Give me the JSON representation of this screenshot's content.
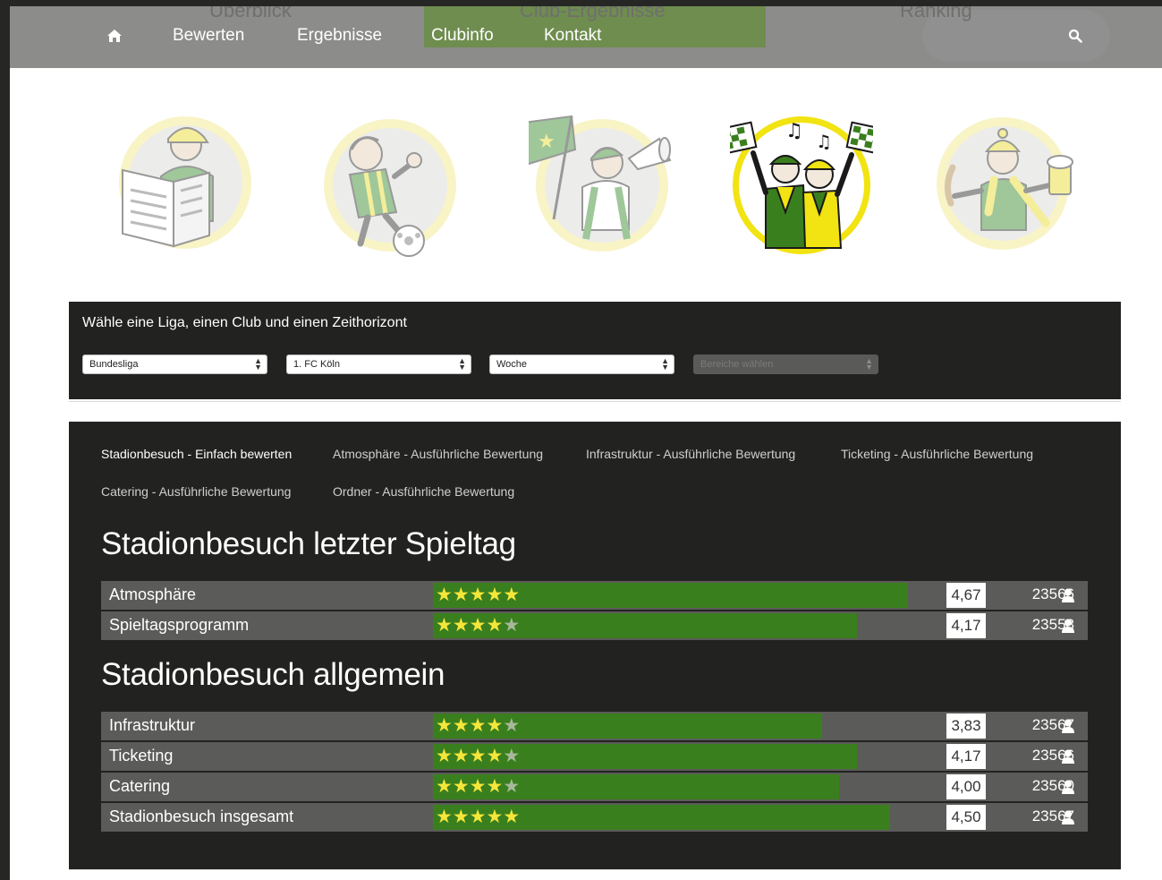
{
  "nav": {
    "ghost_items": [
      "Überblick",
      "Club-Ergebnisse",
      "Ranking"
    ],
    "home_icon": "home-icon",
    "items": [
      "Bewerten",
      "Ergebnisse",
      "Clubinfo",
      "Kontakt"
    ],
    "search_icon": "search-icon",
    "highlight_color": "#6f8d4f"
  },
  "categories": [
    {
      "name": "newspaper-fan-icon",
      "active": false
    },
    {
      "name": "footballer-fan-icon",
      "active": false
    },
    {
      "name": "flag-megaphone-fan-icon",
      "active": false
    },
    {
      "name": "singing-fans-icon",
      "active": true
    },
    {
      "name": "beer-sausage-fan-icon",
      "active": false
    }
  ],
  "filters": {
    "title": "Wähle eine Liga, einen Club und einen Zeithorizont",
    "league": "Bundesliga",
    "club": "1. FC Köln",
    "period": "Woche",
    "areas_placeholder": "Bereiche wählen"
  },
  "tabs": [
    "Stadionbesuch - Einfach bewerten",
    "Atmosphäre - Ausführliche Bewertung",
    "Infrastruktur - Ausführliche Bewertung",
    "Ticketing - Ausführliche Bewertung",
    "Catering - Ausführliche Bewertung",
    "Ordner - Ausführliche Bewertung"
  ],
  "sections": [
    {
      "title": "Stadionbesuch letzter Spieltag",
      "rows": [
        {
          "label": "Atmosphäre",
          "score": "4,67",
          "rating": 4.67,
          "count": "23566"
        },
        {
          "label": "Spieltagsprogramm",
          "score": "4,17",
          "rating": 4.17,
          "count": "23558"
        }
      ]
    },
    {
      "title": "Stadionbesuch allgemein",
      "rows": [
        {
          "label": "Infrastruktur",
          "score": "3,83",
          "rating": 3.83,
          "count": "23567"
        },
        {
          "label": "Ticketing",
          "score": "4,17",
          "rating": 4.17,
          "count": "23566"
        },
        {
          "label": "Catering",
          "score": "4,00",
          "rating": 4.0,
          "count": "23560"
        },
        {
          "label": "Stadionbesuch insgesamt",
          "score": "4,50",
          "rating": 4.5,
          "count": "23567"
        }
      ]
    }
  ],
  "colors": {
    "bar_green": "#3a7f1e",
    "star_yellow": "#f5e63a",
    "panel_dark": "#222220",
    "row_grey": "#5b5b59"
  }
}
